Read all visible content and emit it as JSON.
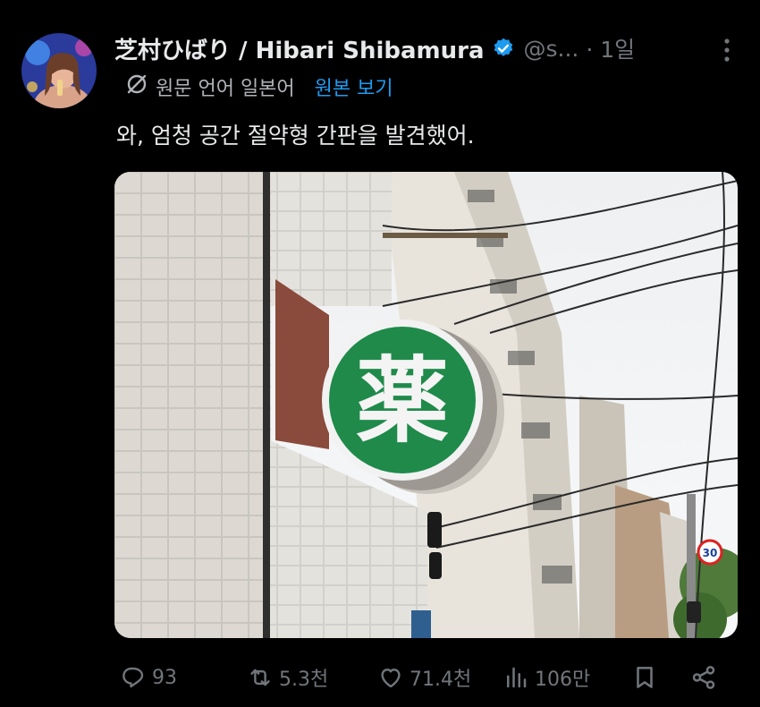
{
  "tweet": {
    "display_name": "芝村ひばり / Hibari Shibamura",
    "handle": "@s...",
    "time": "· 1일",
    "translate_icon": "translate-off-icon",
    "original_language": "원문 언어 일본어",
    "view_original": "원본 보기",
    "text": "와, 엄청 공간 절약형 간판을 발견했어.",
    "sign_character": "薬",
    "speed_sign": "30"
  },
  "actions": {
    "replies": "93",
    "retweets": "5.3천",
    "likes": "71.4천",
    "views": "106만"
  },
  "colors": {
    "background": "#000000",
    "text": "#e7e9ea",
    "muted": "#71767b",
    "link": "#1d9bf0",
    "sign_green": "#1f8a4a"
  }
}
